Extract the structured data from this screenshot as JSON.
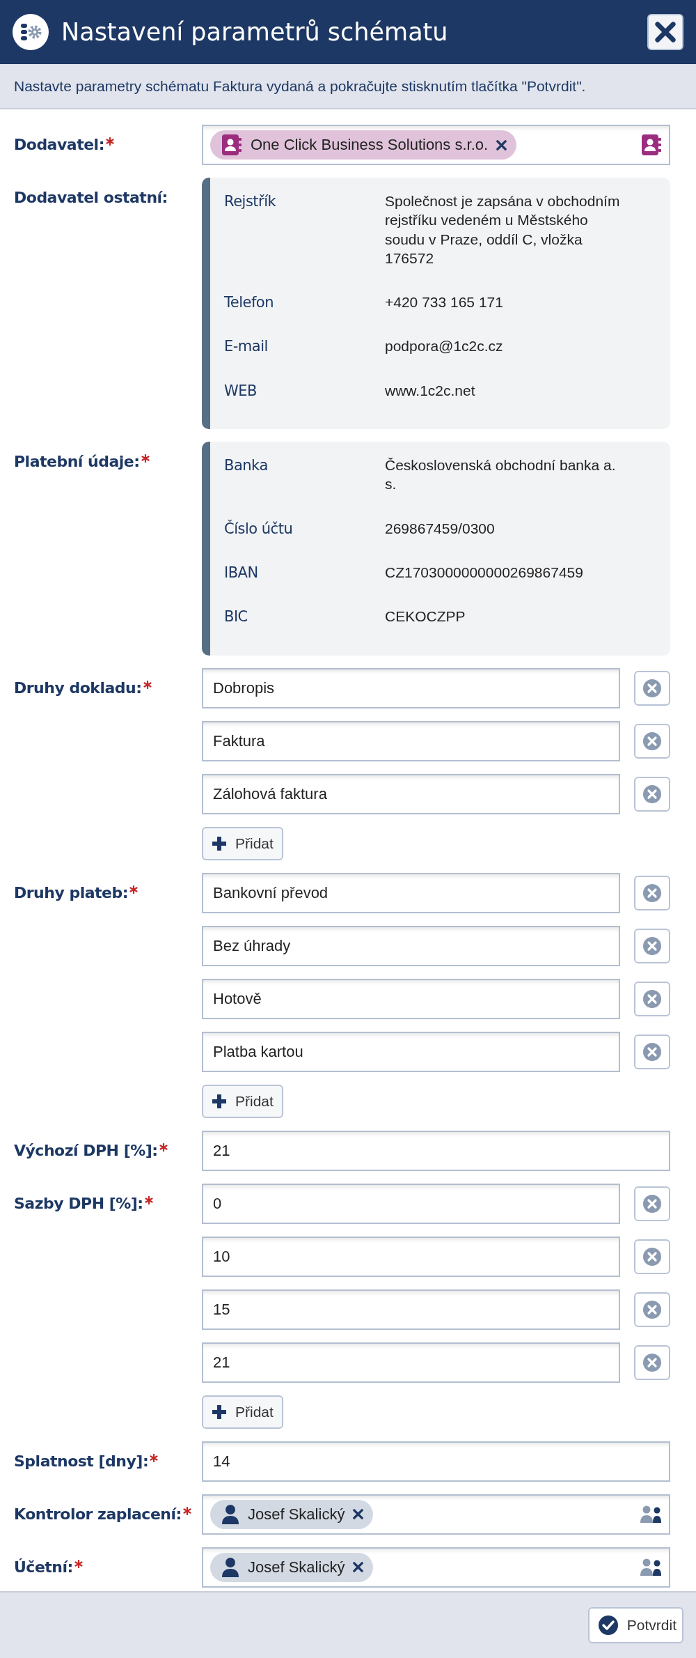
{
  "dialog": {
    "title": "Nastavení parametrů schématu",
    "instructions": "Nastavte parametry schématu Faktura vydaná a pokračujte stisknutím tlačítka \"Potvrdit\"."
  },
  "fields": [
    {
      "kind": "company",
      "label": "Dodavatel:",
      "required": true,
      "tags": [
        "One Click Business Solutions s.r.o."
      ]
    },
    {
      "kind": "info",
      "label": "Dodavatel ostatní:",
      "required": false,
      "rows": [
        {
          "name": "Rejstřík",
          "value": "Společnost je zapsána v obchodním rejstříku vedeném u Městského soudu v Praze, oddíl C, vložka 176572"
        },
        {
          "name": "Telefon",
          "value": "+420 733 165 171"
        },
        {
          "name": "E-mail",
          "value": "podpora@1c2c.cz"
        },
        {
          "name": "WEB",
          "value": "www.1c2c.net"
        }
      ]
    },
    {
      "kind": "info",
      "label": "Platební údaje:",
      "required": true,
      "rows": [
        {
          "name": "Banka",
          "value": "Československá obchodní banka a. s."
        },
        {
          "name": "Číslo účtu",
          "value": "269867459/0300"
        },
        {
          "name": "IBAN",
          "value": "CZ1703000000000269867459"
        },
        {
          "name": "BIC",
          "value": "CEKOCZPP"
        }
      ]
    },
    {
      "kind": "list",
      "label": "Druhy dokladu:",
      "required": true,
      "values": [
        "Dobropis",
        "Faktura",
        "Zálohová faktura"
      ],
      "add_label": "Přidat"
    },
    {
      "kind": "list",
      "label": "Druhy plateb:",
      "required": true,
      "values": [
        "Bankovní převod",
        "Bez úhrady",
        "Hotově",
        "Platba kartou"
      ],
      "add_label": "Přidat"
    },
    {
      "kind": "input",
      "label": "Výchozí DPH [%]:",
      "required": true,
      "value": "21"
    },
    {
      "kind": "list",
      "label": "Sazby DPH [%]:",
      "required": true,
      "values": [
        "0",
        "10",
        "15",
        "21"
      ],
      "add_label": "Přidat"
    },
    {
      "kind": "input",
      "label": "Splatnost [dny]:",
      "required": true,
      "value": "14"
    },
    {
      "kind": "person",
      "label": "Kontrolor zaplacení:",
      "required": true,
      "tags": [
        "Josef Skalický"
      ]
    },
    {
      "kind": "person",
      "label": "Účetní:",
      "required": true,
      "tags": [
        "Josef Skalický"
      ]
    }
  ],
  "footer": {
    "confirm": "Potvrdit"
  }
}
